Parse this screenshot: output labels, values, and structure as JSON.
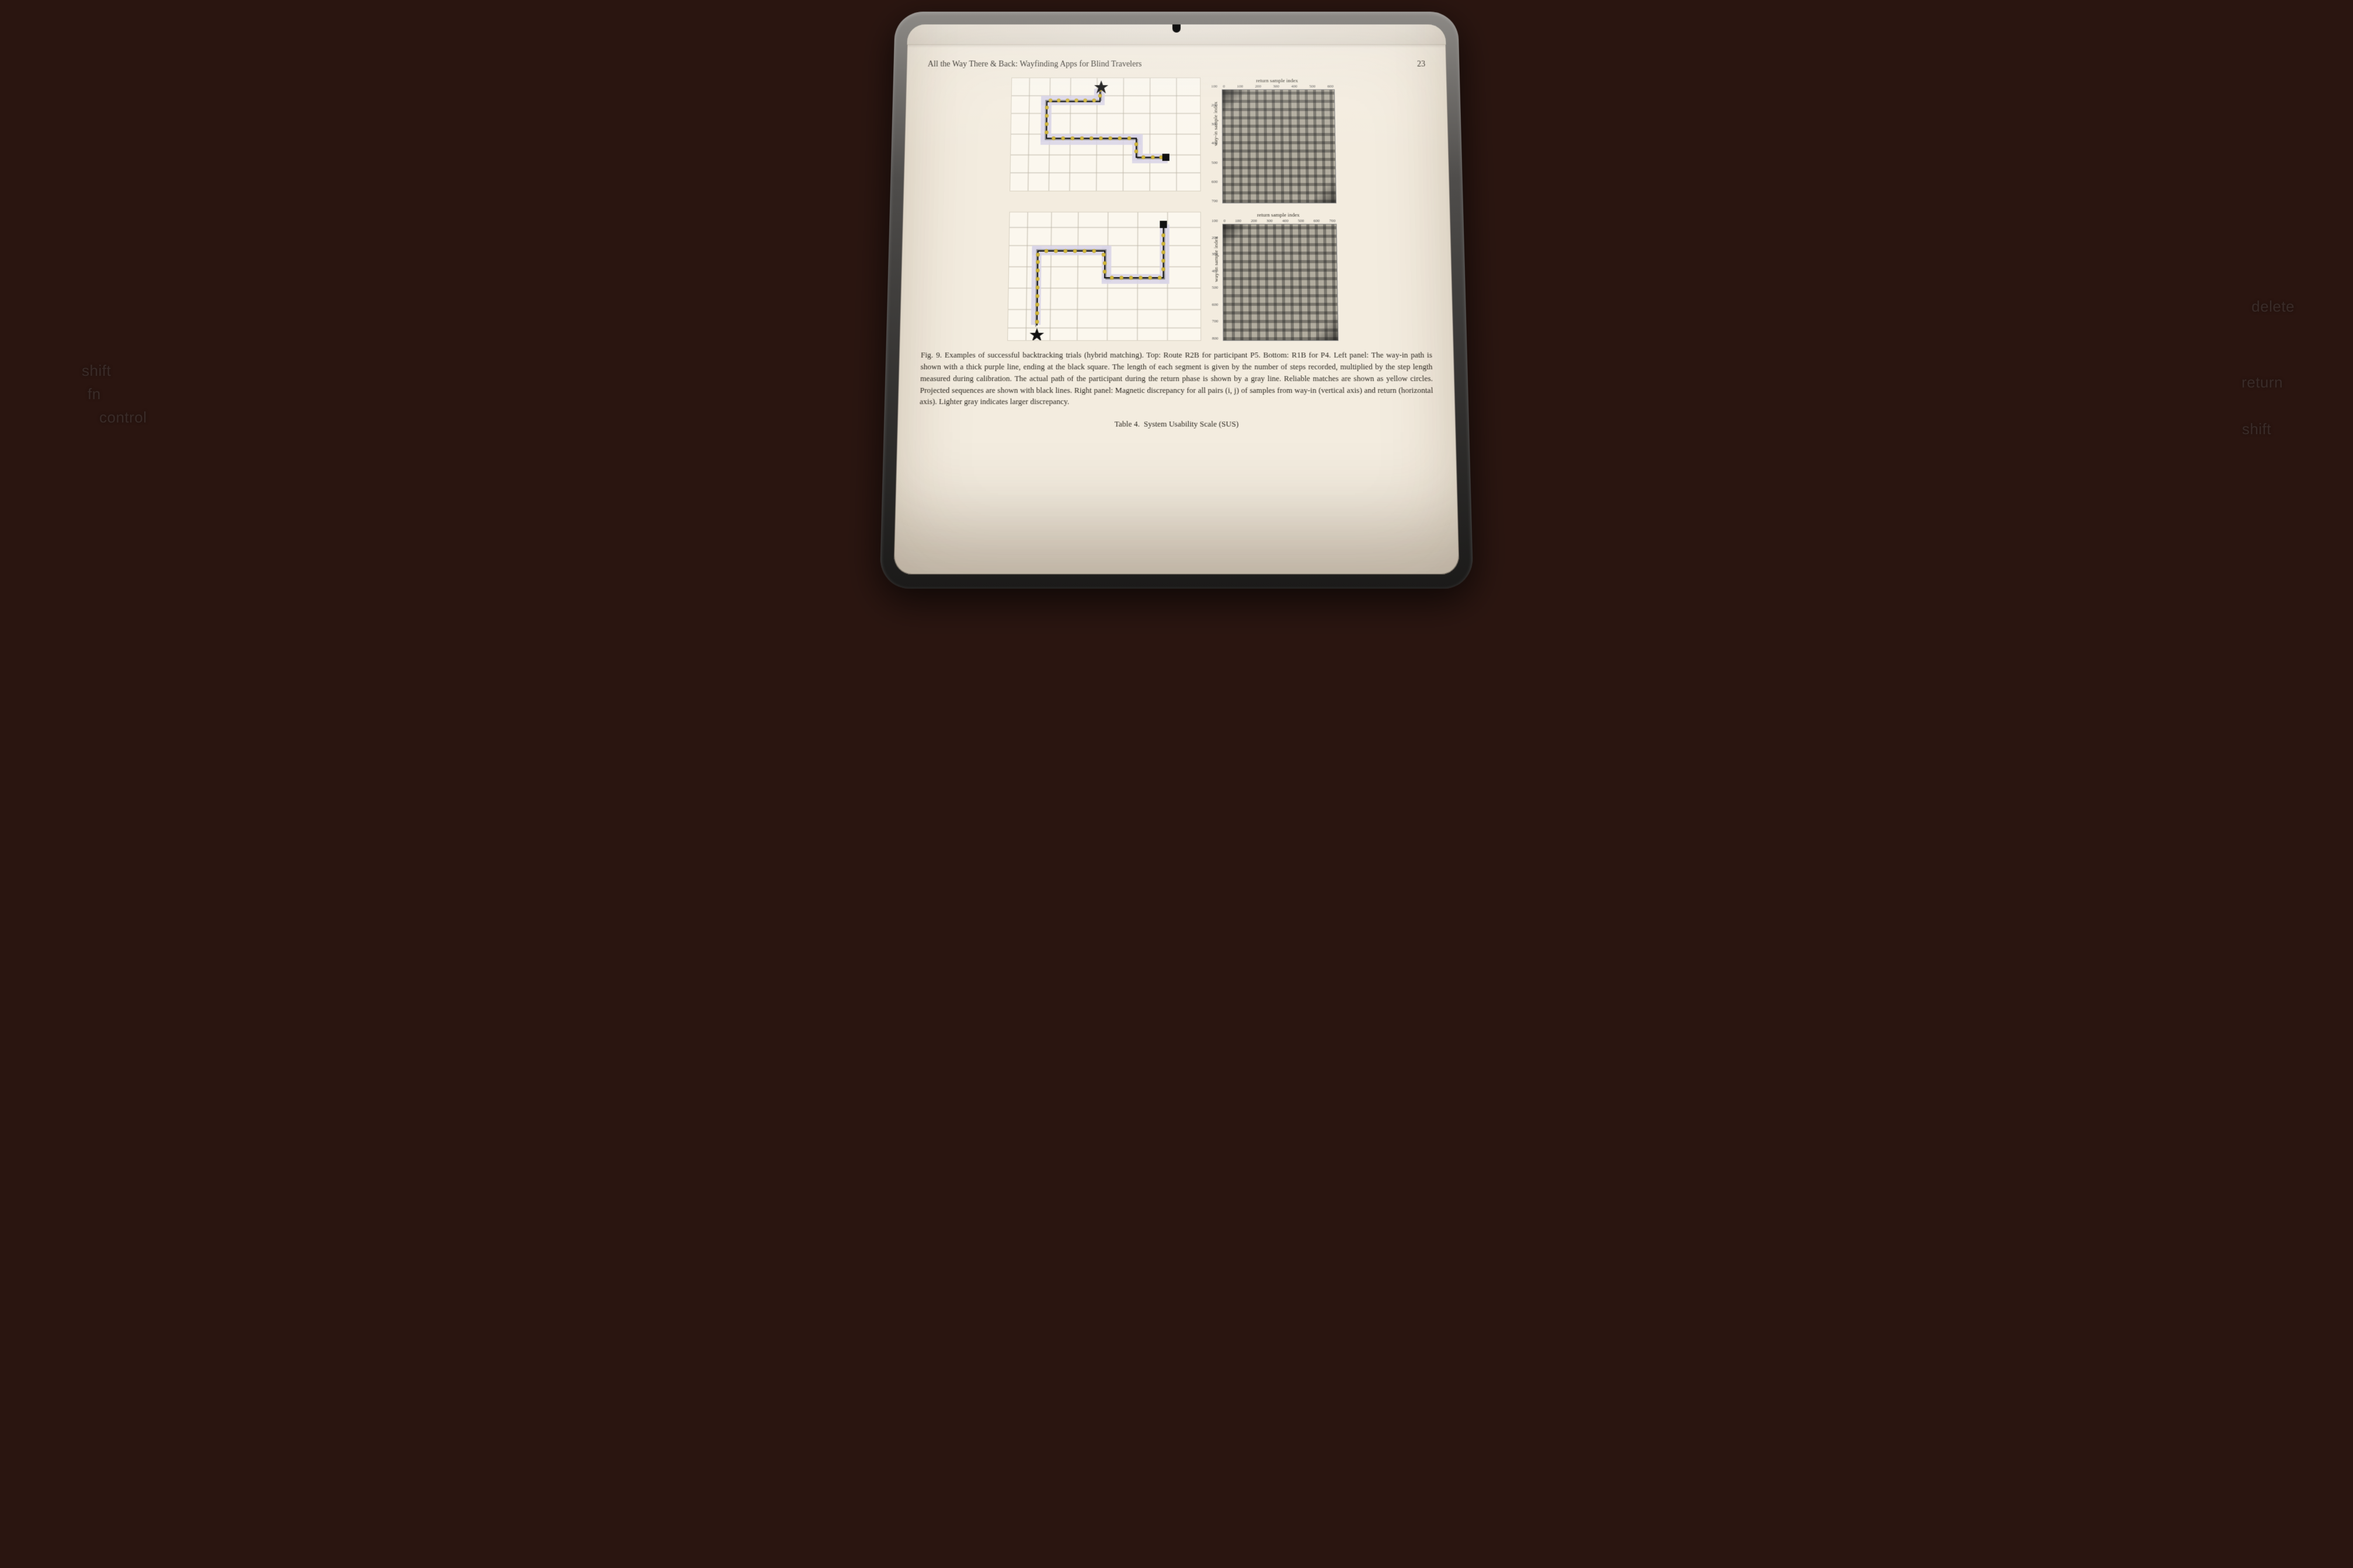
{
  "background_keys": {
    "k1": "shift",
    "k2": "fn",
    "k3": "control",
    "k4": "delete",
    "k5": "return",
    "k6": "shift"
  },
  "page": {
    "running_title": "All the Way There & Back: Wayfinding Apps for Blind Travelers",
    "page_number": "23",
    "figure": {
      "label": "Fig. 9.",
      "caption": "Examples of successful backtracking trials (hybrid matching). Top: Route R2B for participant P5. Bottom: R1B for P4. Left panel: The way-in path is shown with a thick purple line, ending at the black square. The length of each segment is given by the number of steps recorded, multiplied by the step length measured during calibration. The actual path of the participant during the return phase is shown by a gray line. Reliable matches are shown as yellow circles. Projected sequences are shown with black lines. Right panel: Magnetic discrepancy for all pairs (i, j) of samples from way-in (vertical axis) and return (horizontal axis). Lighter gray indicates larger discrepancy."
    },
    "matrix": {
      "x_label": "return sample index",
      "y_label": "way-in sample index",
      "top_ticks_a": [
        "0",
        "100",
        "200",
        "300",
        "400",
        "500",
        "600"
      ],
      "left_ticks_a": [
        "100",
        "200",
        "300",
        "400",
        "500",
        "600",
        "700"
      ],
      "top_ticks_b": [
        "0",
        "100",
        "200",
        "300",
        "400",
        "500",
        "600",
        "700"
      ],
      "left_ticks_b": [
        "100",
        "200",
        "300",
        "400",
        "500",
        "600",
        "700",
        "800"
      ]
    },
    "table_label": "Table 4.",
    "table_title": "System Usability Scale (SUS)"
  }
}
